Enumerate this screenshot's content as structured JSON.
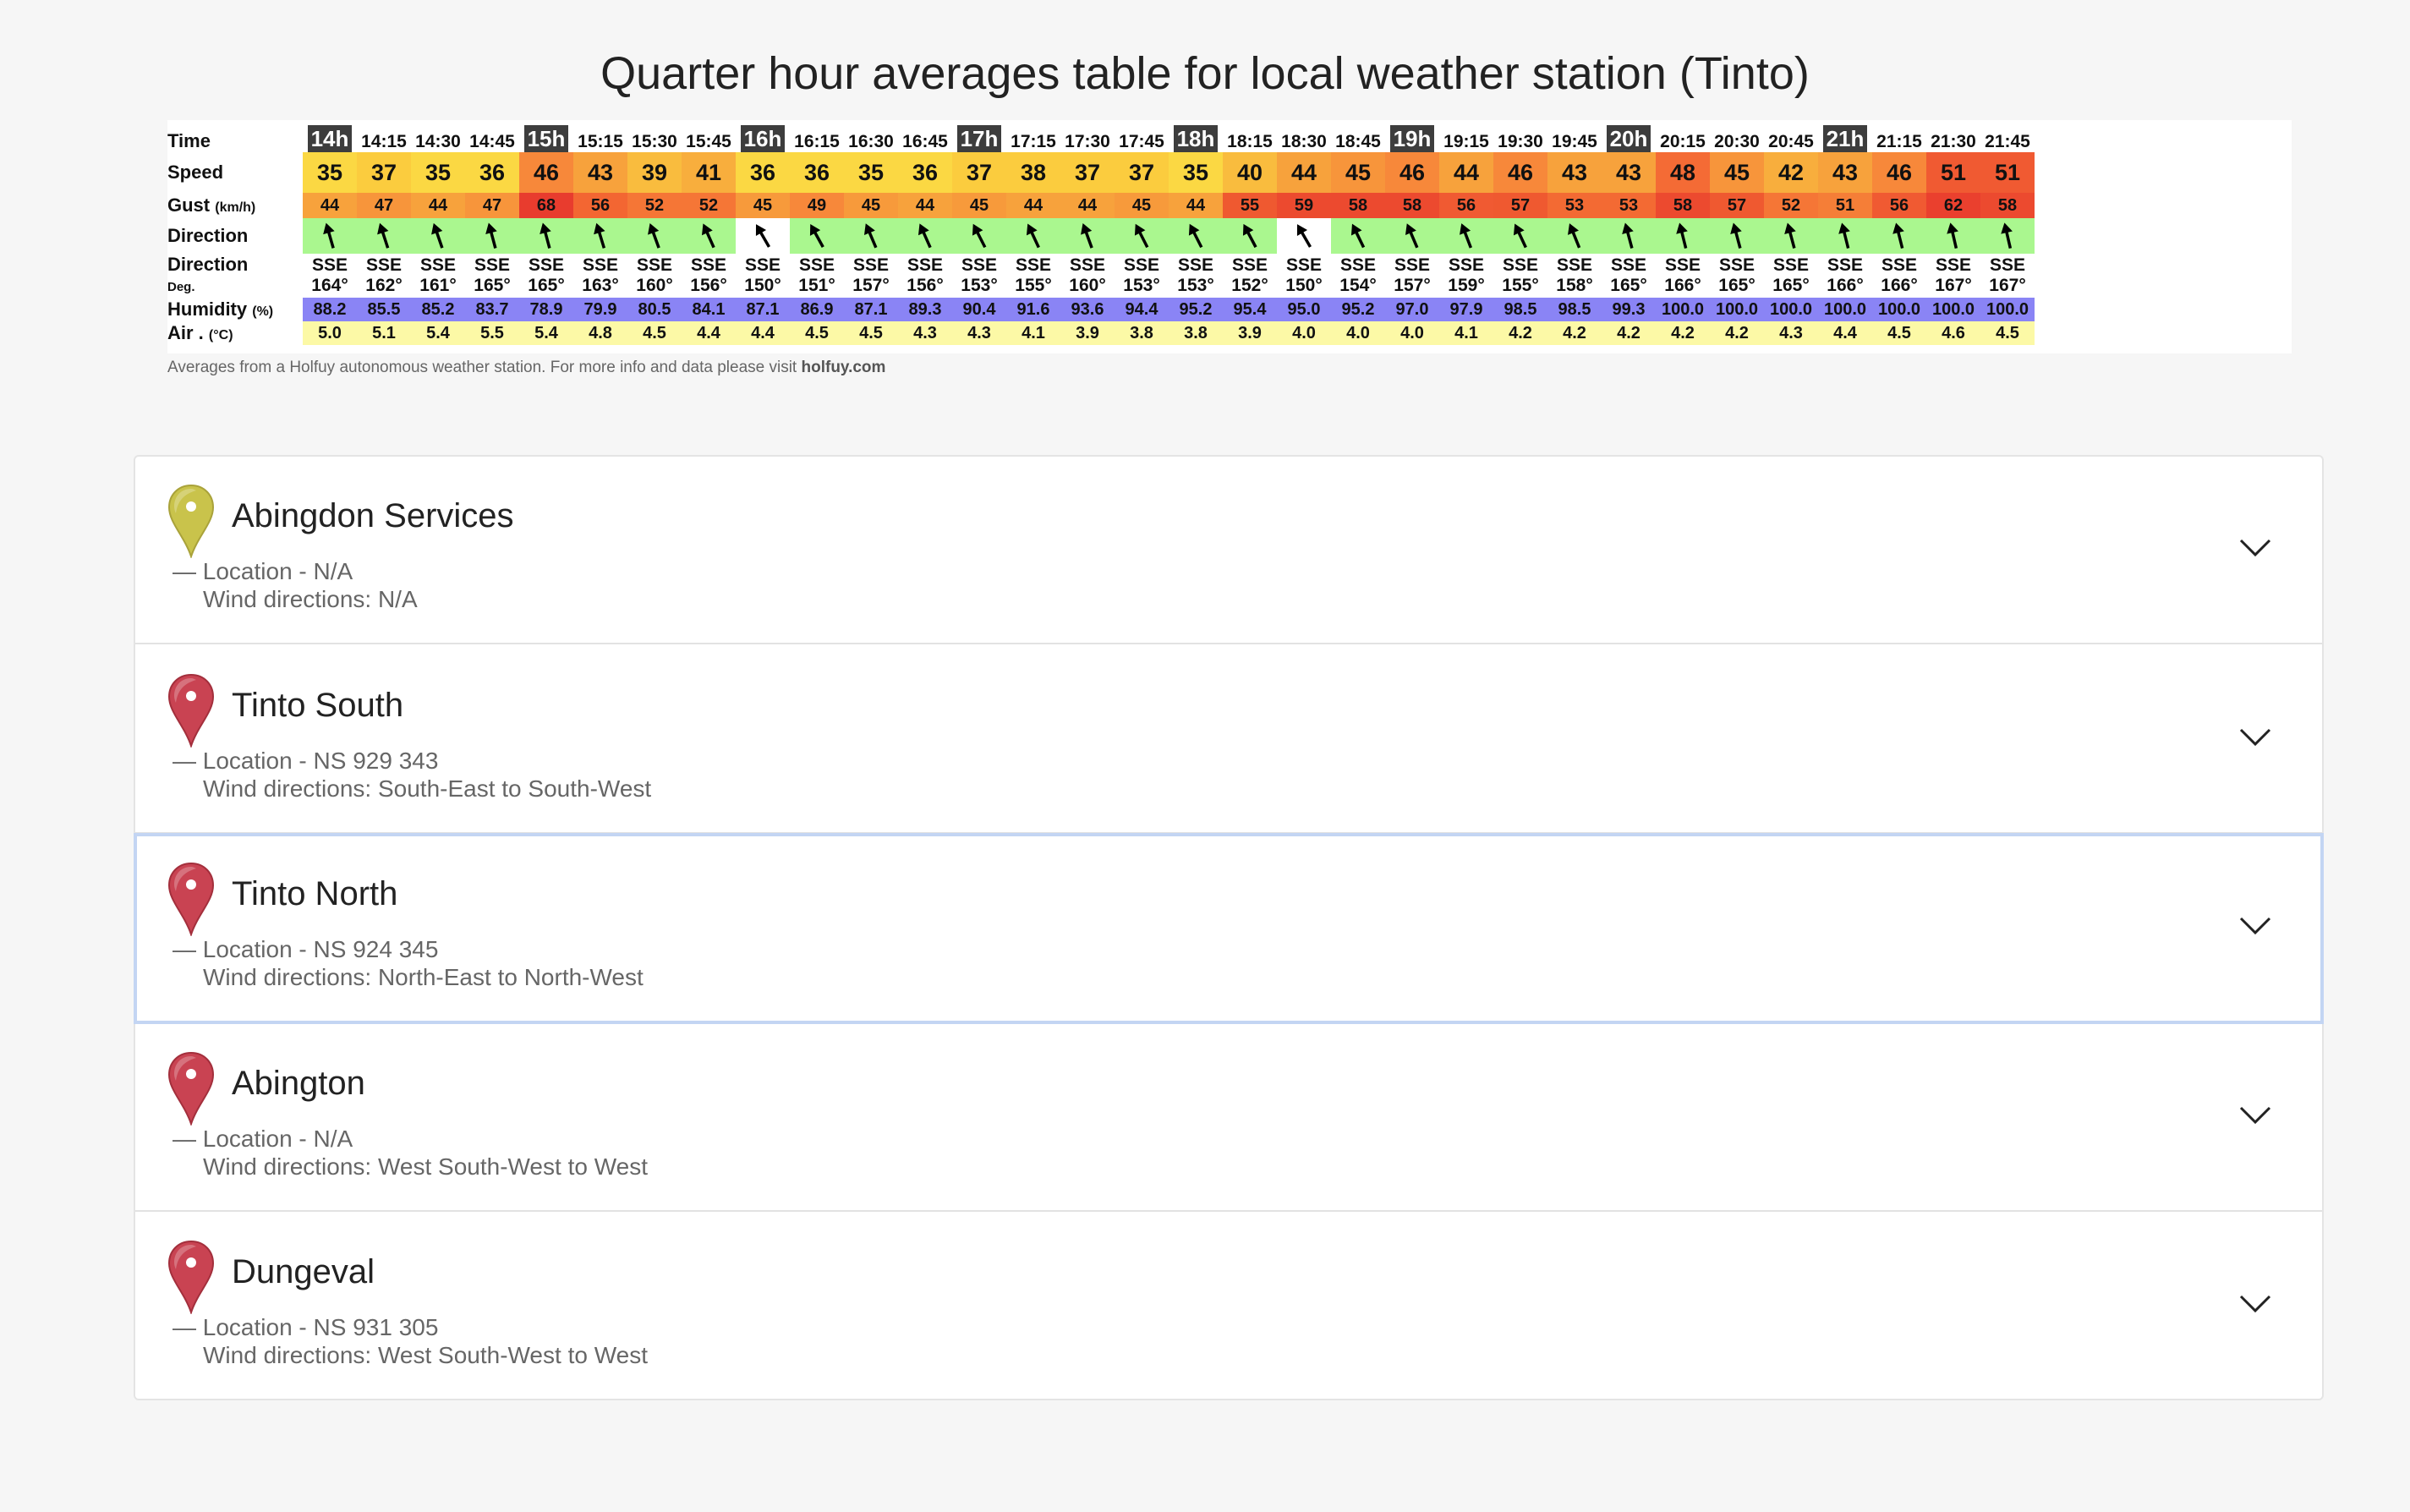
{
  "title": "Quarter hour averages table for local weather station (Tinto)",
  "labels": {
    "time": "Time",
    "speed": "Speed",
    "gust": "Gust",
    "gust_unit": "(km/h)",
    "direction": "Direction",
    "direction2": "Direction",
    "deg": "Deg.",
    "humidity": "Humidity",
    "humidity_unit": "(%)",
    "air": "Air .",
    "air_unit": "(°C)"
  },
  "weather": {
    "times": [
      "14h",
      "14:15",
      "14:30",
      "14:45",
      "15h",
      "15:15",
      "15:30",
      "15:45",
      "16h",
      "16:15",
      "16:30",
      "16:45",
      "17h",
      "17:15",
      "17:30",
      "17:45",
      "18h",
      "18:15",
      "18:30",
      "18:45",
      "19h",
      "19:15",
      "19:30",
      "19:45",
      "20h",
      "20:15",
      "20:30",
      "20:45",
      "21h",
      "21:15",
      "21:30",
      "21:45"
    ],
    "speed": [
      35,
      37,
      35,
      36,
      46,
      43,
      39,
      41,
      36,
      36,
      35,
      36,
      37,
      38,
      37,
      37,
      35,
      40,
      44,
      45,
      46,
      44,
      46,
      43,
      43,
      48,
      45,
      42,
      43,
      46,
      51,
      51
    ],
    "gust": [
      44,
      47,
      44,
      47,
      68,
      56,
      52,
      52,
      45,
      49,
      45,
      44,
      45,
      44,
      44,
      45,
      44,
      55,
      59,
      58,
      58,
      56,
      57,
      53,
      53,
      58,
      57,
      52,
      51,
      56,
      62,
      58
    ],
    "dir_text": [
      "SSE",
      "SSE",
      "SSE",
      "SSE",
      "SSE",
      "SSE",
      "SSE",
      "SSE",
      "SSE",
      "SSE",
      "SSE",
      "SSE",
      "SSE",
      "SSE",
      "SSE",
      "SSE",
      "SSE",
      "SSE",
      "SSE",
      "SSE",
      "SSE",
      "SSE",
      "SSE",
      "SSE",
      "SSE",
      "SSE",
      "SSE",
      "SSE",
      "SSE",
      "SSE",
      "SSE",
      "SSE"
    ],
    "deg": [
      "164°",
      "162°",
      "161°",
      "165°",
      "165°",
      "163°",
      "160°",
      "156°",
      "150°",
      "151°",
      "157°",
      "156°",
      "153°",
      "155°",
      "160°",
      "153°",
      "153°",
      "152°",
      "150°",
      "154°",
      "157°",
      "159°",
      "155°",
      "158°",
      "165°",
      "166°",
      "165°",
      "165°",
      "166°",
      "166°",
      "167°",
      "167°"
    ],
    "deg_values": [
      164,
      162,
      161,
      165,
      165,
      163,
      160,
      156,
      150,
      151,
      157,
      156,
      153,
      155,
      160,
      153,
      153,
      152,
      150,
      154,
      157,
      159,
      155,
      158,
      165,
      166,
      165,
      165,
      166,
      166,
      167,
      167
    ],
    "humidity": [
      "88.2",
      "85.5",
      "85.2",
      "83.7",
      "78.9",
      "79.9",
      "80.5",
      "84.1",
      "87.1",
      "86.9",
      "87.1",
      "89.3",
      "90.4",
      "91.6",
      "93.6",
      "94.4",
      "95.2",
      "95.4",
      "95.0",
      "95.2",
      "97.0",
      "97.9",
      "98.5",
      "98.5",
      "99.3",
      "100.0",
      "100.0",
      "100.0",
      "100.0",
      "100.0",
      "100.0",
      "100.0"
    ],
    "air": [
      "5.0",
      "5.1",
      "5.4",
      "5.5",
      "5.4",
      "4.8",
      "4.5",
      "4.4",
      "4.4",
      "4.5",
      "4.5",
      "4.3",
      "4.3",
      "4.1",
      "3.9",
      "3.8",
      "3.8",
      "3.9",
      "4.0",
      "4.0",
      "4.0",
      "4.1",
      "4.2",
      "4.2",
      "4.2",
      "4.2",
      "4.2",
      "4.3",
      "4.4",
      "4.5",
      "4.6",
      "4.5"
    ],
    "speed_colors": [
      "#fbd843",
      "#fbcc3e",
      "#fbd843",
      "#fbd843",
      "#f7883a",
      "#f7a23c",
      "#f9bc3e",
      "#f8ae3d",
      "#fbd843",
      "#fbd843",
      "#fbd843",
      "#fbd843",
      "#fbcc3e",
      "#fbcc3e",
      "#fbcc3e",
      "#fbcc3e",
      "#fbd843",
      "#f9bc3e",
      "#f7a23c",
      "#f7953b",
      "#f7883a",
      "#f7a23c",
      "#f7883a",
      "#f7a23c",
      "#f7a23c",
      "#f46b35",
      "#f7953b",
      "#f8ae3d",
      "#f7a23c",
      "#f7883a",
      "#f05a32",
      "#f05a32"
    ],
    "gust_colors": [
      "#f7a23c",
      "#f7953b",
      "#f7a23c",
      "#f7953b",
      "#e83c2e",
      "#f36632",
      "#f57636",
      "#f57636",
      "#f79a3b",
      "#f7883a",
      "#f79a3b",
      "#f7a23c",
      "#f79a3b",
      "#f7a23c",
      "#f7a23c",
      "#f79a3b",
      "#f7a23c",
      "#ef5930",
      "#ec4a2f",
      "#ec4a2f",
      "#ec4a2f",
      "#f05a32",
      "#ef5930",
      "#f36a33",
      "#f36a33",
      "#ec4a2f",
      "#ef5930",
      "#f57636",
      "#f57e37",
      "#f05a32",
      "#ea402e",
      "#ec4a2f"
    ],
    "dir_white": [
      8,
      18
    ]
  },
  "footnote": {
    "text": "Averages from a Holfuy autonomous weather station. For more info and data please visit ",
    "link": "holfuy.com"
  },
  "locations": [
    {
      "name": "Abingdon Services",
      "location": "— Location - N/A",
      "wind": "Wind directions: N/A",
      "pin_color": "#c9c34b",
      "pin_dark": "#a9a23a"
    },
    {
      "name": "Tinto South",
      "location": "— Location - NS 929 343",
      "wind": "Wind directions: South-East to South-West",
      "pin_color": "#c94352",
      "pin_dark": "#a32f3c"
    },
    {
      "name": "Tinto North",
      "location": "— Location - NS 924 345",
      "wind": "Wind directions: North-East to North-West",
      "pin_color": "#c94352",
      "pin_dark": "#a32f3c"
    },
    {
      "name": "Abington",
      "location": "— Location - N/A",
      "wind": "Wind directions: West South-West to West",
      "pin_color": "#c94352",
      "pin_dark": "#a32f3c"
    },
    {
      "name": "Dungeval",
      "location": "— Location - NS 931 305",
      "wind": "Wind directions: West South-West to West",
      "pin_color": "#c94352",
      "pin_dark": "#a32f3c"
    }
  ]
}
